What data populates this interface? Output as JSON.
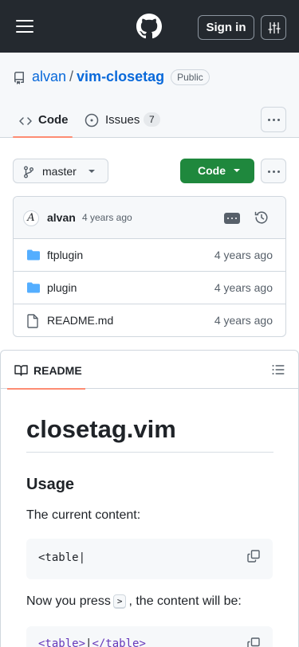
{
  "header": {
    "menu_icon": "hamburger-icon",
    "logo_icon": "github-mark-icon",
    "signin_label": "Sign in",
    "settings_icon": "sliders-icon"
  },
  "repo": {
    "owner": "alvan",
    "separator": "/",
    "name": "vim-closetag",
    "visibility": "Public"
  },
  "tabs": [
    {
      "label": "Code",
      "icon": "code-icon",
      "selected": true
    },
    {
      "label": "Issues",
      "icon": "issue-opened-icon",
      "count": "7"
    }
  ],
  "toolbar": {
    "branch": "master",
    "code_button": "Code"
  },
  "commit": {
    "avatar_letter": "A",
    "author": "alvan",
    "time": "4 years ago"
  },
  "files": [
    {
      "type": "folder",
      "name": "ftplugin",
      "time": "4 years ago"
    },
    {
      "type": "folder",
      "name": "plugin",
      "time": "4 years ago"
    },
    {
      "type": "file",
      "name": "README.md",
      "time": "4 years ago"
    }
  ],
  "readme": {
    "tab_label": "README",
    "h1": "closetag.vim",
    "h2": "Usage",
    "p1": "The current content:",
    "code1": "<table|",
    "p2_before": "Now you press",
    "p2_key": ">",
    "p2_after": ", the content will be:",
    "code2_open": "<table>",
    "code2_cursor": "|",
    "code2_close": "</table>"
  },
  "colors": {
    "header_bg": "#24292f",
    "link": "#0969da",
    "primary_button": "#1f883d",
    "tab_underline": "#fd8c73"
  }
}
